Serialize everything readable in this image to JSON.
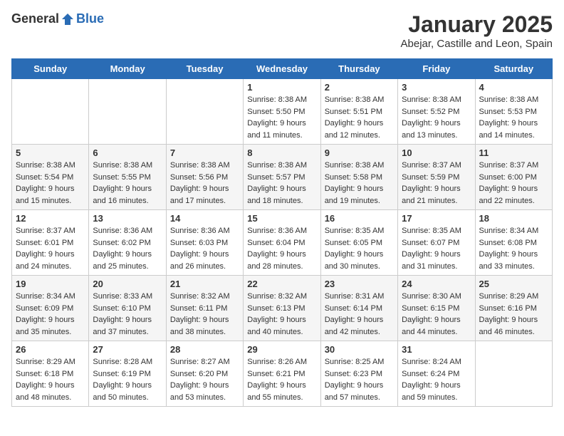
{
  "header": {
    "logo_general": "General",
    "logo_blue": "Blue",
    "title": "January 2025",
    "subtitle": "Abejar, Castille and Leon, Spain"
  },
  "days_of_week": [
    "Sunday",
    "Monday",
    "Tuesday",
    "Wednesday",
    "Thursday",
    "Friday",
    "Saturday"
  ],
  "weeks": [
    [
      {
        "day": null,
        "info": null
      },
      {
        "day": null,
        "info": null
      },
      {
        "day": null,
        "info": null
      },
      {
        "day": "1",
        "info": "Sunrise: 8:38 AM\nSunset: 5:50 PM\nDaylight: 9 hours and 11 minutes."
      },
      {
        "day": "2",
        "info": "Sunrise: 8:38 AM\nSunset: 5:51 PM\nDaylight: 9 hours and 12 minutes."
      },
      {
        "day": "3",
        "info": "Sunrise: 8:38 AM\nSunset: 5:52 PM\nDaylight: 9 hours and 13 minutes."
      },
      {
        "day": "4",
        "info": "Sunrise: 8:38 AM\nSunset: 5:53 PM\nDaylight: 9 hours and 14 minutes."
      }
    ],
    [
      {
        "day": "5",
        "info": "Sunrise: 8:38 AM\nSunset: 5:54 PM\nDaylight: 9 hours and 15 minutes."
      },
      {
        "day": "6",
        "info": "Sunrise: 8:38 AM\nSunset: 5:55 PM\nDaylight: 9 hours and 16 minutes."
      },
      {
        "day": "7",
        "info": "Sunrise: 8:38 AM\nSunset: 5:56 PM\nDaylight: 9 hours and 17 minutes."
      },
      {
        "day": "8",
        "info": "Sunrise: 8:38 AM\nSunset: 5:57 PM\nDaylight: 9 hours and 18 minutes."
      },
      {
        "day": "9",
        "info": "Sunrise: 8:38 AM\nSunset: 5:58 PM\nDaylight: 9 hours and 19 minutes."
      },
      {
        "day": "10",
        "info": "Sunrise: 8:37 AM\nSunset: 5:59 PM\nDaylight: 9 hours and 21 minutes."
      },
      {
        "day": "11",
        "info": "Sunrise: 8:37 AM\nSunset: 6:00 PM\nDaylight: 9 hours and 22 minutes."
      }
    ],
    [
      {
        "day": "12",
        "info": "Sunrise: 8:37 AM\nSunset: 6:01 PM\nDaylight: 9 hours and 24 minutes."
      },
      {
        "day": "13",
        "info": "Sunrise: 8:36 AM\nSunset: 6:02 PM\nDaylight: 9 hours and 25 minutes."
      },
      {
        "day": "14",
        "info": "Sunrise: 8:36 AM\nSunset: 6:03 PM\nDaylight: 9 hours and 26 minutes."
      },
      {
        "day": "15",
        "info": "Sunrise: 8:36 AM\nSunset: 6:04 PM\nDaylight: 9 hours and 28 minutes."
      },
      {
        "day": "16",
        "info": "Sunrise: 8:35 AM\nSunset: 6:05 PM\nDaylight: 9 hours and 30 minutes."
      },
      {
        "day": "17",
        "info": "Sunrise: 8:35 AM\nSunset: 6:07 PM\nDaylight: 9 hours and 31 minutes."
      },
      {
        "day": "18",
        "info": "Sunrise: 8:34 AM\nSunset: 6:08 PM\nDaylight: 9 hours and 33 minutes."
      }
    ],
    [
      {
        "day": "19",
        "info": "Sunrise: 8:34 AM\nSunset: 6:09 PM\nDaylight: 9 hours and 35 minutes."
      },
      {
        "day": "20",
        "info": "Sunrise: 8:33 AM\nSunset: 6:10 PM\nDaylight: 9 hours and 37 minutes."
      },
      {
        "day": "21",
        "info": "Sunrise: 8:32 AM\nSunset: 6:11 PM\nDaylight: 9 hours and 38 minutes."
      },
      {
        "day": "22",
        "info": "Sunrise: 8:32 AM\nSunset: 6:13 PM\nDaylight: 9 hours and 40 minutes."
      },
      {
        "day": "23",
        "info": "Sunrise: 8:31 AM\nSunset: 6:14 PM\nDaylight: 9 hours and 42 minutes."
      },
      {
        "day": "24",
        "info": "Sunrise: 8:30 AM\nSunset: 6:15 PM\nDaylight: 9 hours and 44 minutes."
      },
      {
        "day": "25",
        "info": "Sunrise: 8:29 AM\nSunset: 6:16 PM\nDaylight: 9 hours and 46 minutes."
      }
    ],
    [
      {
        "day": "26",
        "info": "Sunrise: 8:29 AM\nSunset: 6:18 PM\nDaylight: 9 hours and 48 minutes."
      },
      {
        "day": "27",
        "info": "Sunrise: 8:28 AM\nSunset: 6:19 PM\nDaylight: 9 hours and 50 minutes."
      },
      {
        "day": "28",
        "info": "Sunrise: 8:27 AM\nSunset: 6:20 PM\nDaylight: 9 hours and 53 minutes."
      },
      {
        "day": "29",
        "info": "Sunrise: 8:26 AM\nSunset: 6:21 PM\nDaylight: 9 hours and 55 minutes."
      },
      {
        "day": "30",
        "info": "Sunrise: 8:25 AM\nSunset: 6:23 PM\nDaylight: 9 hours and 57 minutes."
      },
      {
        "day": "31",
        "info": "Sunrise: 8:24 AM\nSunset: 6:24 PM\nDaylight: 9 hours and 59 minutes."
      },
      {
        "day": null,
        "info": null
      }
    ]
  ]
}
